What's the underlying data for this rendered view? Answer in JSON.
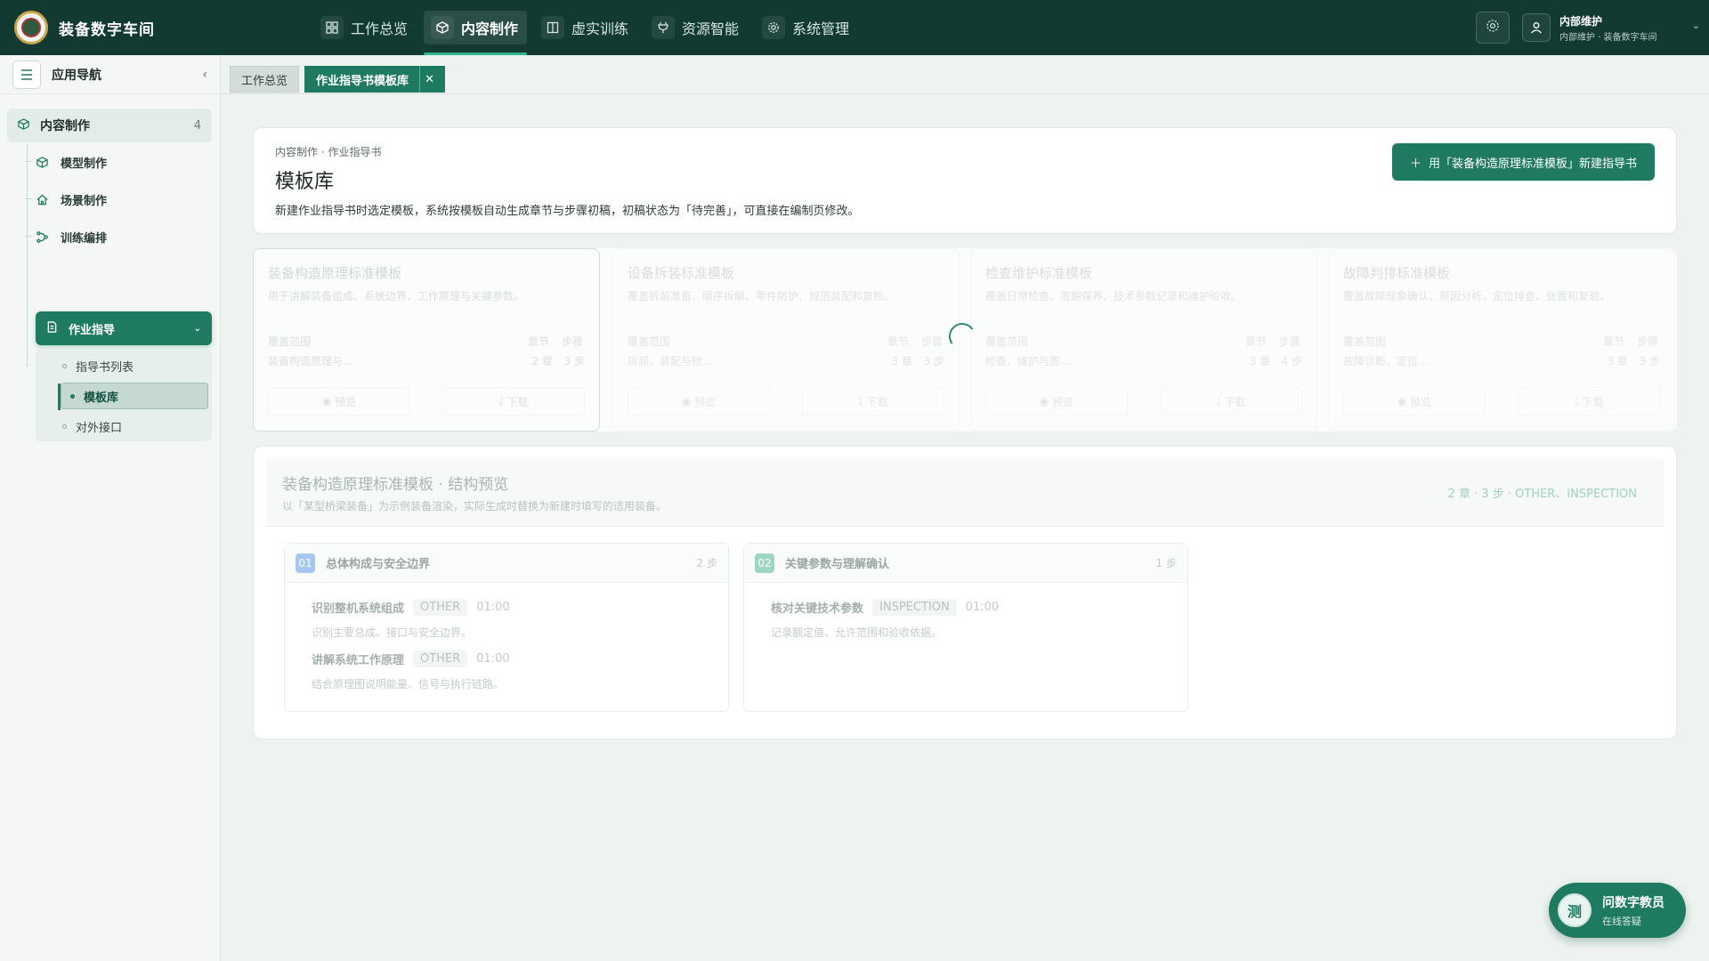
{
  "app": {
    "title": "装备数字车间"
  },
  "nav": [
    {
      "label": "工作总览",
      "icon": "dashboard-icon"
    },
    {
      "label": "内容制作",
      "icon": "cube-icon",
      "active": true
    },
    {
      "label": "虚实训练",
      "icon": "book-icon"
    },
    {
      "label": "资源智能",
      "icon": "plug-icon"
    },
    {
      "label": "系统管理",
      "icon": "gear-icon"
    }
  ],
  "user": {
    "name": "内部维护",
    "sub": "内部维护 · 装备数字车间"
  },
  "sidebar": {
    "title": "应用导航",
    "group": {
      "label": "内容制作",
      "count": "4"
    },
    "items": [
      {
        "label": "模型制作",
        "icon": "cube-icon"
      },
      {
        "label": "场景制作",
        "icon": "home-icon"
      },
      {
        "label": "训练编排",
        "icon": "flow-icon"
      }
    ],
    "active_item": {
      "label": "作业指导",
      "icon": "doc-icon"
    },
    "sub_items": [
      {
        "label": "指导书列表"
      },
      {
        "label": "模板库",
        "active": true
      },
      {
        "label": "对外接口"
      }
    ]
  },
  "tabs": [
    {
      "label": "工作总览"
    },
    {
      "label": "作业指导书模板库",
      "active": true
    }
  ],
  "header": {
    "breadcrumb": "内容制作 · 作业指导书",
    "title": "模板库",
    "desc": "新建作业指导书时选定模板，系统按模板自动生成章节与步骤初稿，初稿状态为「待完善」，可直接在编制页修改。",
    "new_button": "用「装备构造原理标准模板」新建指导书"
  },
  "templates": [
    {
      "title": "装备构造原理标准模板",
      "desc": "用于讲解装备组成、系统边界、工作原理与关键参数。",
      "scope_label": "覆盖范围",
      "scope": "装备构造原理与...",
      "chap_label": "章节",
      "step_label": "步骤",
      "chapters": "2 章",
      "steps": "3 步",
      "preview": "预览",
      "download": "下载"
    },
    {
      "title": "设备拆装标准模板",
      "desc": "覆盖拆前准备、顺序拆解、零件防护、规范装配和复检。",
      "scope_label": "覆盖范围",
      "scope": "拆卸、装配与检...",
      "chap_label": "章节",
      "step_label": "步骤",
      "chapters": "3 章",
      "steps": "3 步",
      "preview": "预览",
      "download": "下载"
    },
    {
      "title": "检查维护标准模板",
      "desc": "覆盖日常检查、周期保养、技术参数记录和维护验收。",
      "scope_label": "覆盖范围",
      "scope": "检查、维护与周...",
      "chap_label": "章节",
      "step_label": "步骤",
      "chapters": "3 章",
      "steps": "4 步",
      "preview": "预览",
      "download": "下载"
    },
    {
      "title": "故障判排标准模板",
      "desc": "覆盖故障现象确认、原因分析、定位排查、处置和复验。",
      "scope_label": "覆盖范围",
      "scope": "故障诊断、定位...",
      "chap_label": "章节",
      "step_label": "步骤",
      "chapters": "3 章",
      "steps": "3 步",
      "preview": "预览",
      "download": "下载"
    }
  ],
  "preview": {
    "title": "装备构造原理标准模板 · 结构预览",
    "sub": "以「某型桥梁装备」为示例装备渲染，实际生成时替换为新建时填写的适用装备。",
    "meta": "2 章 · 3 步 · OTHER、INSPECTION",
    "chapters": [
      {
        "no": "01",
        "name": "总体构成与安全边界",
        "steps_count": "2 步",
        "steps": [
          {
            "name": "识别整机系统组成",
            "type": "OTHER",
            "time": "01:00",
            "desc": "识别主要总成、接口与安全边界。"
          },
          {
            "name": "讲解系统工作原理",
            "type": "OTHER",
            "time": "01:00",
            "desc": "结合原理图说明能量、信号与执行链路。"
          }
        ]
      },
      {
        "no": "02",
        "name": "关键参数与理解确认",
        "steps_count": "1 步",
        "steps": [
          {
            "name": "核对关键技术参数",
            "type": "INSPECTION",
            "time": "01:00",
            "desc": "记录额定值、允许范围和验收依据。"
          }
        ]
      }
    ]
  },
  "assistant": {
    "avatar": "测",
    "name": "问数字教员",
    "sub": "在线答疑"
  }
}
